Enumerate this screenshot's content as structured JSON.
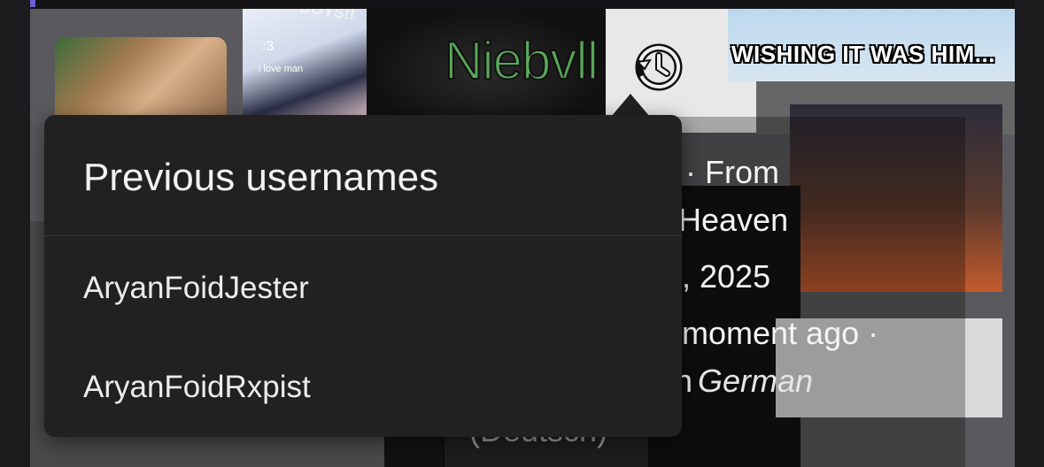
{
  "profile": {
    "username": "Niebvll",
    "history_icon": "history-icon",
    "username_color": "#5aa85a",
    "details": {
      "line1": "e · From",
      "line2": "Heaven",
      "line3": ", 2025",
      "line4": "moment ago ·",
      "line5_prefix": "n",
      "line5_language": "German",
      "line6": "(Deutsch)"
    }
  },
  "background": {
    "banner_text": "WISHING IT WAS HIM...",
    "sticker_text": "BOYS!!",
    "sticker_small": ":3",
    "sticker_love": "i love man"
  },
  "popup": {
    "title": "Previous usernames",
    "items": [
      {
        "label": "AryanFoidJester"
      },
      {
        "label": "AryanFoidRxpist"
      }
    ],
    "background_color": "#212121"
  }
}
